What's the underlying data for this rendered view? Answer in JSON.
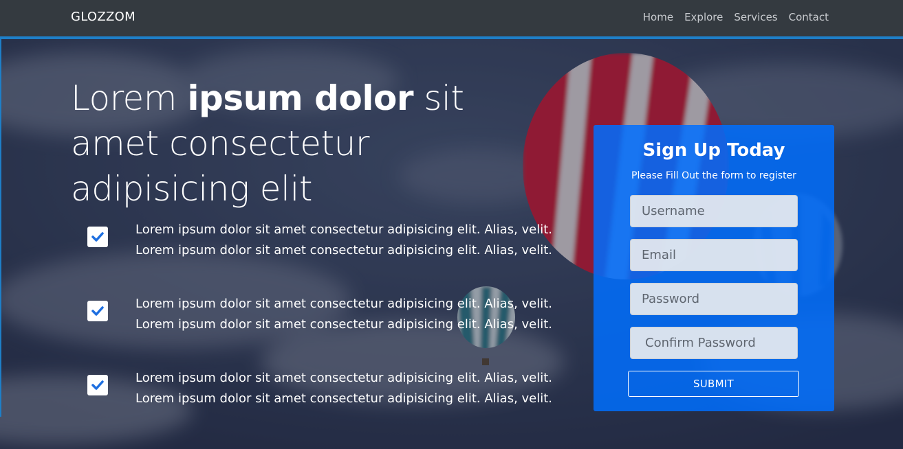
{
  "navbar": {
    "brand": "GLOZZOM",
    "links": [
      "Home",
      "Explore",
      "Services",
      "Contact"
    ]
  },
  "hero": {
    "headline_pre": "Lorem ",
    "headline_bold": "ipsum dolor",
    "headline_post": " sit amet consectetur adipisicing elit",
    "features": [
      "Lorem ipsum dolor sit amet consectetur adipisicing elit. Alias, velit. Lorem ipsum dolor sit amet consectetur adipisicing elit. Alias, velit.",
      "Lorem ipsum dolor sit amet consectetur adipisicing elit. Alias, velit. Lorem ipsum dolor sit amet consectetur adipisicing elit. Alias, velit.",
      "Lorem ipsum dolor sit amet consectetur adipisicing elit. Alias, velit. Lorem ipsum dolor sit amet consectetur adipisicing elit. Alias, velit."
    ]
  },
  "signup": {
    "title": "Sign Up Today",
    "subtitle": "Please Fill Out the form to register",
    "username_placeholder": "Username",
    "email_placeholder": "Email",
    "password_placeholder": "Password",
    "confirm_placeholder": "Confirm Password",
    "submit_label": "SUBMIT"
  },
  "colors": {
    "navbar_bg": "#343a40",
    "accent": "#1e7fc8",
    "card_bg": "#006eff",
    "check": "#1e6fe0"
  },
  "icons": [
    "check-icon"
  ]
}
